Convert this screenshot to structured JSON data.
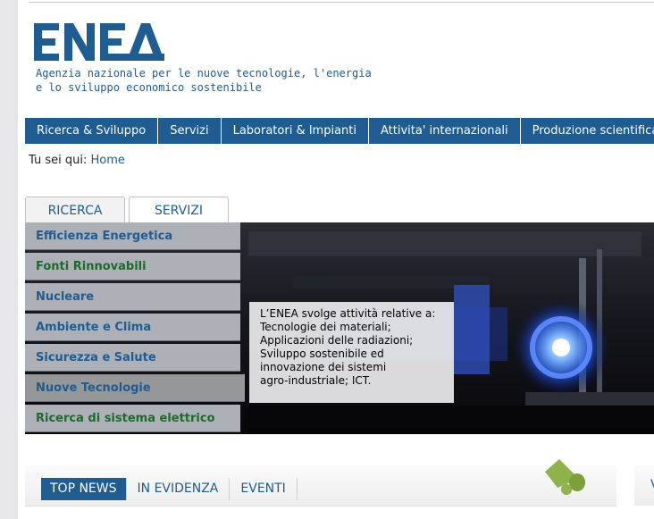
{
  "logo": {
    "text": "ENEA",
    "tagline_line1": "Agenzia nazionale per le nuove tecnologie, l'energia",
    "tagline_line2": "e lo sviluppo economico sostenibile",
    "color": "#1e5c92"
  },
  "mainnav": [
    "Ricerca & Sviluppo",
    "Servizi",
    "Laboratori & Impianti",
    "Attivita' internazionali",
    "Produzione scientifica"
  ],
  "breadcrumb": {
    "prefix": "Tu sei qui:",
    "home": "Home"
  },
  "tabs": [
    "RICERCA",
    "SERVIZI"
  ],
  "side_menu": [
    {
      "label": "Efficienza Energetica"
    },
    {
      "label": "Fonti Rinnovabili"
    },
    {
      "label": "Nucleare"
    },
    {
      "label": "Ambiente e Clima"
    },
    {
      "label": "Sicurezza e Salute"
    },
    {
      "label": "Nuove Tecnologie"
    },
    {
      "label": "Ricerca di sistema elettrico"
    }
  ],
  "hero_text": [
    "L’ENEA svolge attività relative a:",
    "Tecnologie dei materiali;",
    "Applicazioni delle radiazioni;",
    "Sviluppo sostenibile ed",
    "innovazione dei sistemi",
    "agro-industriale; ICT."
  ],
  "news_tabs": [
    "TOP NEWS",
    "IN EVIDENZA",
    "EVENTI"
  ],
  "right_panel_initial": "V",
  "colors": {
    "brand_blue": "#1e5c92",
    "menu_green": "#1b6b2a",
    "megaphone_green": "#8fb24a"
  }
}
